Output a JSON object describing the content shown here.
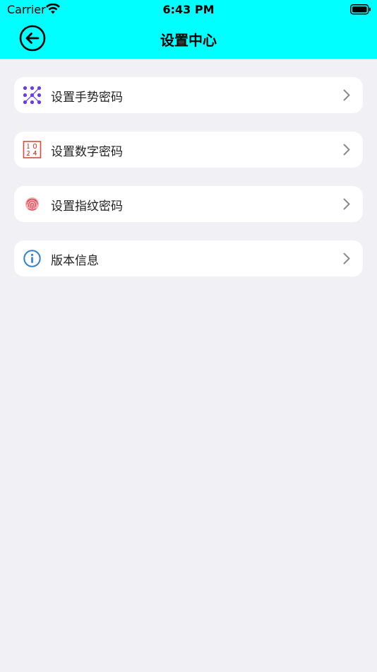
{
  "status_bar": {
    "carrier": "Carrier",
    "time": "6:43 PM"
  },
  "header": {
    "title": "设置中心",
    "background": "#00ffff"
  },
  "menu": {
    "items": [
      {
        "label": "设置手势密码",
        "icon": "gesture-dots-icon",
        "color": "#6a3de8"
      },
      {
        "label": "设置数字密码",
        "icon": "number-pad-icon",
        "color": "#d84a3c"
      },
      {
        "label": "设置指纹密码",
        "icon": "fingerprint-icon",
        "color": "#d84a5a"
      },
      {
        "label": "版本信息",
        "icon": "info-icon",
        "color": "#2f7fd0"
      }
    ]
  }
}
